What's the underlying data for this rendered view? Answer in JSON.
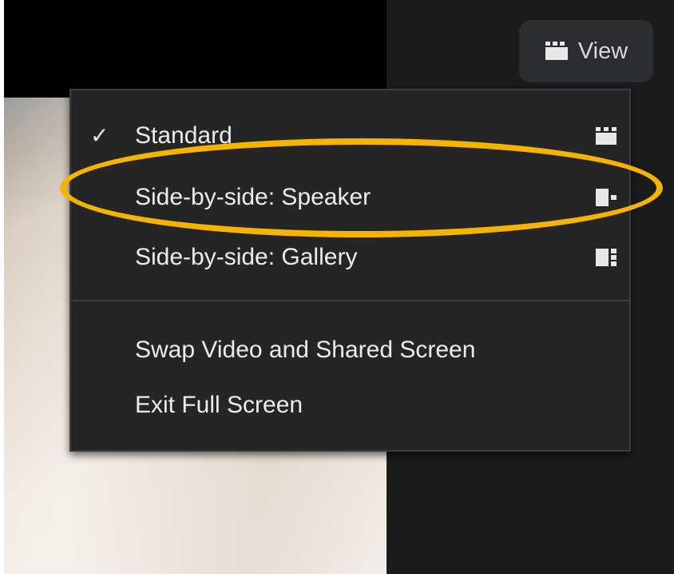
{
  "colors": {
    "menu_background": "#252526",
    "highlight_ring": "#f5b400",
    "text": "#ececec"
  },
  "view_button": {
    "label": "View",
    "icon": "layout-grid-icon"
  },
  "menu": {
    "items": [
      {
        "label": "Standard",
        "checked": true,
        "icon": "standard-layout-icon"
      },
      {
        "label": "Side-by-side: Speaker",
        "checked": false,
        "icon": "side-by-side-speaker-icon",
        "highlighted": true
      },
      {
        "label": "Side-by-side: Gallery",
        "checked": false,
        "icon": "side-by-side-gallery-icon"
      },
      {
        "label": "Swap Video and Shared Screen",
        "checked": false
      },
      {
        "label": "Exit Full Screen",
        "checked": false
      }
    ],
    "check_glyph": "✓"
  }
}
